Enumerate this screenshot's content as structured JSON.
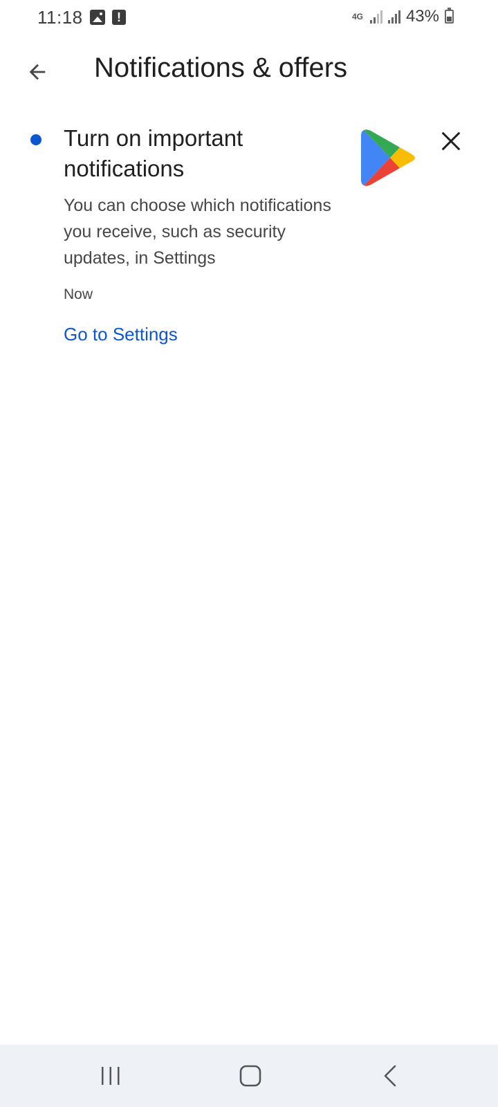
{
  "status_bar": {
    "time": "11:18",
    "network_type": "4G",
    "battery_percent": "43%",
    "battery_level": 0.43,
    "icons": [
      "image-icon",
      "alert-icon",
      "signal-icon",
      "battery-icon"
    ]
  },
  "header": {
    "title": "Notifications & offers",
    "back_icon": "arrow-back-icon"
  },
  "notification": {
    "title": "Turn on important notifications",
    "body": "You can choose which notifications you receive, such as security updates, in Settings",
    "time": "Now",
    "action_label": "Go to Settings",
    "unread": true,
    "app_icon": "google-play-logo",
    "close_icon": "close-icon"
  },
  "nav_bar": {
    "icons": [
      "recent-apps-icon",
      "home-icon",
      "back-icon"
    ]
  },
  "colors": {
    "accent": "#0b57d0",
    "text_primary": "#1f1f1f",
    "text_secondary": "#444746",
    "nav_background": "#eef1f6",
    "play_green": "#34a853",
    "play_yellow": "#fbbc04",
    "play_red": "#ea4335",
    "play_blue": "#4285f4"
  }
}
